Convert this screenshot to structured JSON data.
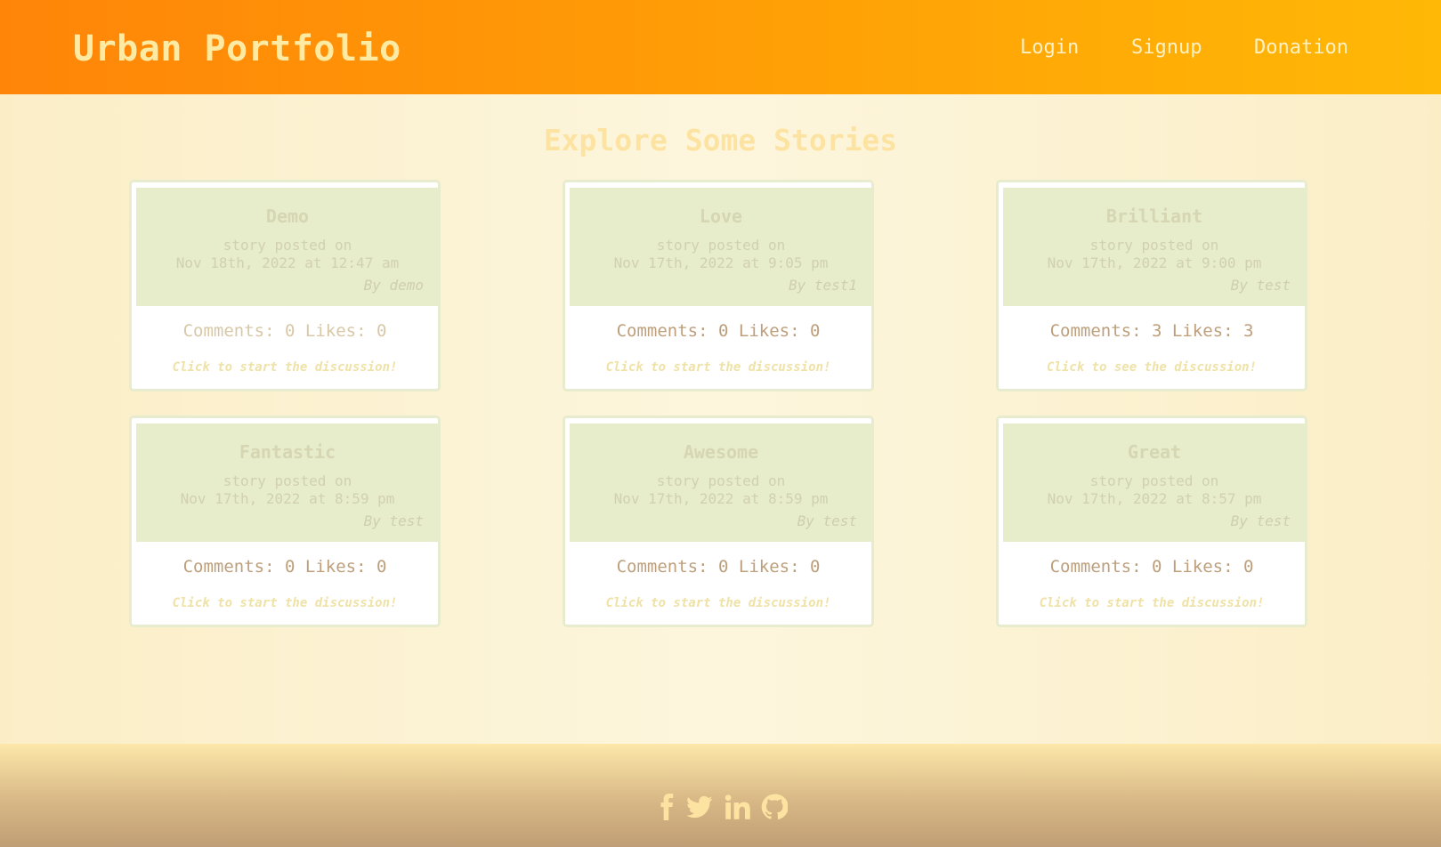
{
  "header": {
    "brand": "Urban Portfolio",
    "nav": {
      "login": "Login",
      "signup": "Signup",
      "donation": "Donation"
    }
  },
  "main": {
    "title": "Explore Some Stories",
    "stories": [
      {
        "title": "Demo",
        "posted_label": "story posted on",
        "date": "Nov 18th, 2022 at 12:47 am",
        "author": "By demo",
        "stats": "Comments: 0 Likes: 0",
        "cta": "Click to start the discussion!"
      },
      {
        "title": "Love",
        "posted_label": "story posted on",
        "date": "Nov 17th, 2022 at 9:05 pm",
        "author": "By test1",
        "stats": "Comments: 0 Likes: 0",
        "cta": "Click to start the discussion!"
      },
      {
        "title": "Brilliant",
        "posted_label": "story posted on",
        "date": "Nov 17th, 2022 at 9:00 pm",
        "author": "By test",
        "stats": "Comments: 3 Likes: 3",
        "cta": "Click to see the discussion!"
      },
      {
        "title": "Fantastic",
        "posted_label": "story posted on",
        "date": "Nov 17th, 2022 at 8:59 pm",
        "author": "By test",
        "stats": "Comments: 0 Likes: 0",
        "cta": "Click to start the discussion!"
      },
      {
        "title": "Awesome",
        "posted_label": "story posted on",
        "date": "Nov 17th, 2022 at 8:59 pm",
        "author": "By test",
        "stats": "Comments: 0 Likes: 0",
        "cta": "Click to start the discussion!"
      },
      {
        "title": "Great",
        "posted_label": "story posted on",
        "date": "Nov 17th, 2022 at 8:57 pm",
        "author": "By test",
        "stats": "Comments: 0 Likes: 0",
        "cta": "Click to start the discussion!"
      }
    ]
  },
  "footer": {
    "icons": [
      "facebook-icon",
      "twitter-icon",
      "linkedin-icon",
      "github-icon"
    ]
  },
  "colors": {
    "header_start": "#ff8508",
    "header_end": "#ffb806",
    "page_bg": "#fdf6dd",
    "card_head": "#e7eccb",
    "footer_end": "#c09e75"
  }
}
